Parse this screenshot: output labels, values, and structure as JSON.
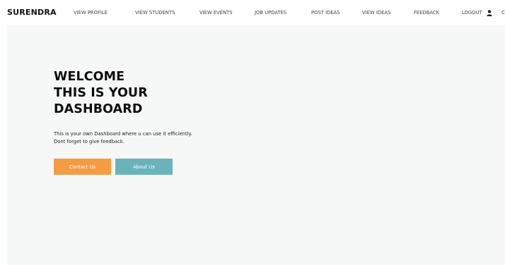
{
  "header": {
    "brand": "SURENDRA",
    "nav": [
      {
        "label": "VIEW PROFILE"
      },
      {
        "label": "VIEW STUDENTS"
      },
      {
        "label": "VIEW EVENTS"
      },
      {
        "label": "JOB UPDATES"
      },
      {
        "label": "POST IDEAS"
      },
      {
        "label": "VIEW IDEAS"
      },
      {
        "label": "FEEDBACK"
      },
      {
        "label": "LOGOUT"
      }
    ],
    "logout_icon": "user-icon",
    "edge_glyph": "C"
  },
  "hero": {
    "title_lines": [
      "WELCOME",
      "THIS IS YOUR",
      "DASHBOARD"
    ],
    "description_lines": [
      "This is your own Dashboard where u can use it efficiently.",
      "Dont forget to give feedback."
    ],
    "contact_label": "Contact Us",
    "about_label": "About Us"
  },
  "colors": {
    "hero_background": "#f6f7f7",
    "contact_button": "#f59b44",
    "about_button": "#6bb3bb"
  }
}
